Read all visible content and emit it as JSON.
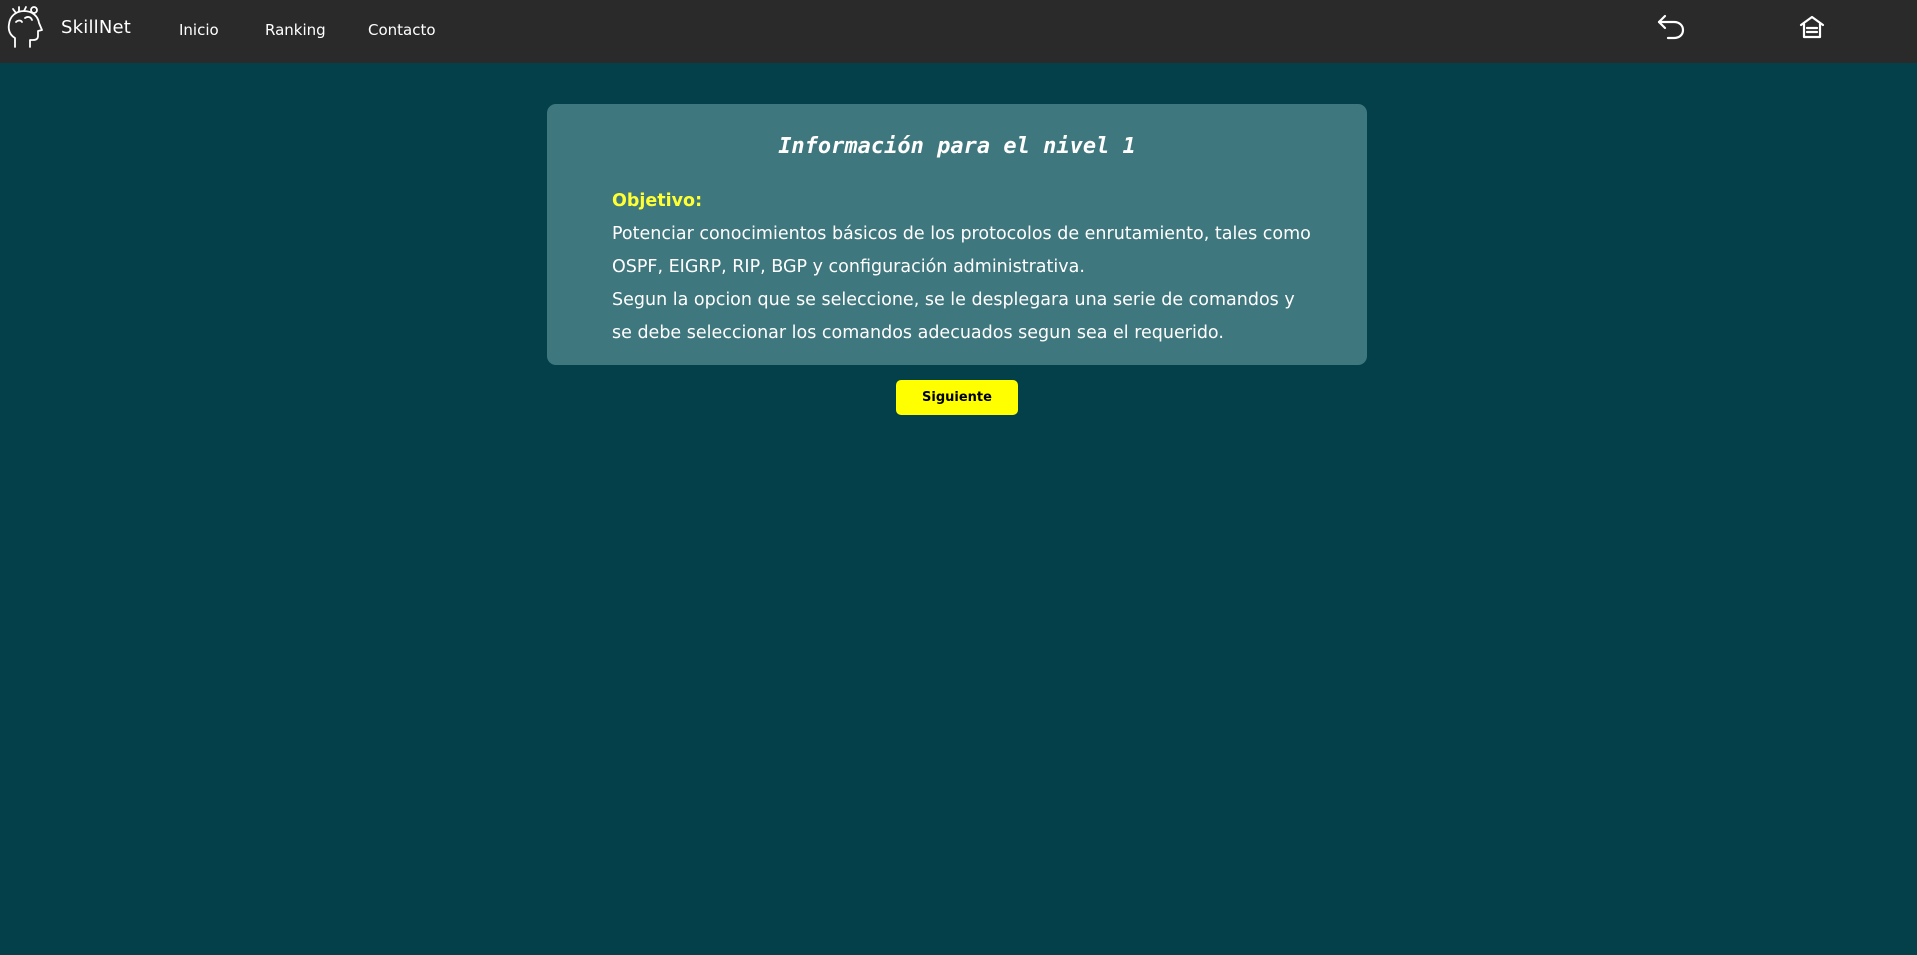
{
  "navbar": {
    "brand": "SkillNet",
    "links": [
      {
        "label": "Inicio"
      },
      {
        "label": "Ranking"
      },
      {
        "label": "Contacto"
      }
    ],
    "icons": [
      "back-arrow-icon",
      "home-icon"
    ],
    "background": "#2a2a2a"
  },
  "card": {
    "title": "Información para el nivel 1",
    "objective_label": "Objetivo:",
    "paragraph_1": "Potenciar conocimientos básicos de los protocolos de enrutamiento, tales como OSPF, EIGRP, RIP, BGP y configuración administrativa.",
    "paragraph_2": "Segun la opcion que se seleccione, se le desplegara una serie de comandos y se debe seleccionar los comandos adecuados segun sea el requerido."
  },
  "next_button": {
    "label": "Siguiente"
  },
  "colors": {
    "page_background": "#03404a",
    "card_background": "#3f777e",
    "accent_yellow": "#ffff00",
    "objective_label": "#ffff33"
  }
}
